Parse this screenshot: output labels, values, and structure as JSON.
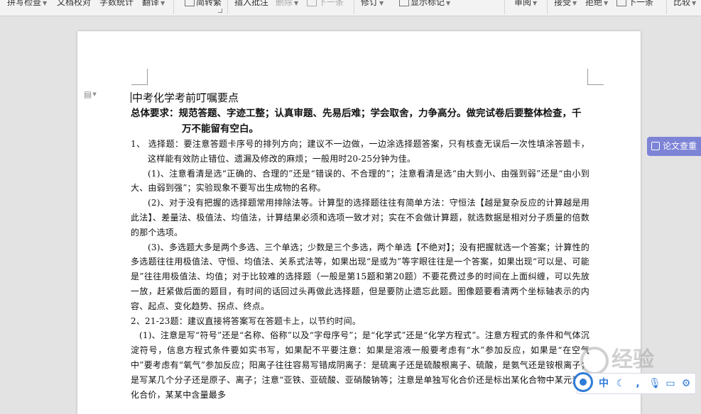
{
  "ribbon": {
    "items": [
      "拼写检查",
      "文档校对",
      "字数统计",
      "翻译",
      "简转繁",
      "插入批注",
      "删除",
      "下一条",
      "修订",
      "显示标记",
      "审阅",
      "接受",
      "拒绝",
      "下一条",
      "比较"
    ]
  },
  "document": {
    "title": "中考化学考前叮嘱要点",
    "requirement": "总体要求：规范答题、字迹工整；认真审题、先易后难；学会取舍，力争高分。做完试卷后要整体检查，千万不能留有空白。",
    "paragraphs": [
      "1、 选择题：要注意答题卡序号的排列方向；建议不一边做，一边涂选择题答案，只有核查无误后一次性填涂答题卡，这样能有效防止错位、遗漏及修改的麻烦；一般用时20-25分钟为佳。",
      "(1)、注意看清是选“正确的、合理的”还是“错误的、不合理的”；注意看清是选“由大到小、由强到弱”还是“由小到大、由弱到强”；实验现象不要写出生成物的名称。",
      "(2)、对于没有把握的选择题常用排除法等。计算型的选择题往往有简单方法：守恒法【越是复杂反应的计算越是用此法】、差量法、极值法、均值法，计算结果必须和选项一致才对；实在不会做计算题，就选数据是相对分子质量的倍数的那个选项。",
      "(3)、多选题大多是两个多选、三个单选；少数是三个多选，两个单选【不绝对】；没有把握就选一个答案；计算性的多选题往往用极值法、守恒、均值法、关系式法等，如果出现“是或为”等字眼往往是一个答案，如果出现“可以是、可能是”往往用极值法、均值；对于比较难的选择题（一般是第15题和第20题）不要花费过多的时间在上面纠缠，可以先放一放，赶紧做后面的题目，有时间的话回过头再做此选择题，但是要防止遗忘此题。图像题要看清两个坐标轴表示的内容、起点、变化趋势、拐点、终点。",
      "2、21-23题：建议直接将答案写在答题卡上，以节约时间。",
      "(1)、注意是写“符号”还是“名称、俗称”以及“字母序号”；是“化学式”还是“化学方程式”。注意方程式的条件和气体沉淀符号，信息方程式条件要如实书写，如果配不平要注意：如果是溶液一般要考虑有“水”参加反应，如果是“在空气中”要考虑有“氧气”参加反应；阳离子往往容易写错成阴离子：是硫离子还是硫酸根离子、硫酸，是氨气还是铵根离子；是写某几个分子还是原子、离子；注意“亚铁、亚硫酸、亚硝酸钠等；注意是单独写化合价还是标出某化合物中某元素的化合价，某某中含量最多"
    ]
  },
  "side_tab": {
    "label": "论文查重"
  },
  "watermark": {
    "text": "经验"
  },
  "ime": {
    "mode_label": "中",
    "icons": [
      "moon-icon",
      "comma-icon",
      "microphone-icon",
      "keyboard-icon",
      "gear-icon"
    ]
  }
}
